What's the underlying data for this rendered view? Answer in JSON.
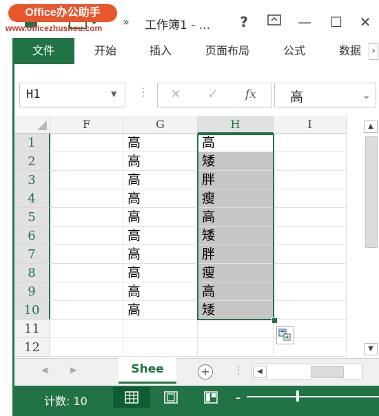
{
  "watermark": {
    "logo": "Office办公助手",
    "url": "www.officezhushou.com"
  },
  "titlebar": {
    "title": "工作簿1 - ...",
    "help": "?",
    "restore": "⊡",
    "minimize": "—",
    "maximize": "☐",
    "close": "✕",
    "more": "»"
  },
  "ribbon": {
    "tabs": [
      "文件",
      "开始",
      "插入",
      "页面布局",
      "公式",
      "数据"
    ],
    "scroll": "›"
  },
  "formula_bar": {
    "name_box": "H1",
    "fx": "fx",
    "cancel": "✕",
    "enter": "✓",
    "value": "高"
  },
  "columns": [
    "F",
    "G",
    "H",
    "I"
  ],
  "rows": [
    "1",
    "2",
    "3",
    "4",
    "5",
    "6",
    "7",
    "8",
    "9",
    "10",
    "11",
    "12"
  ],
  "col_g": [
    "高",
    "高",
    "高",
    "高",
    "高",
    "高",
    "高",
    "高",
    "高",
    "高"
  ],
  "col_h": [
    "高",
    "矮",
    "胖",
    "瘦",
    "高",
    "矮",
    "胖",
    "瘦",
    "高",
    "矮"
  ],
  "sheet": {
    "tab_label": "Shee",
    "add": "+"
  },
  "status": {
    "count": "计数: 10"
  },
  "colors": {
    "accent": "#217346",
    "selection": "#c6c6c6"
  },
  "icons": {
    "paste_options": "paste-options-icon"
  }
}
